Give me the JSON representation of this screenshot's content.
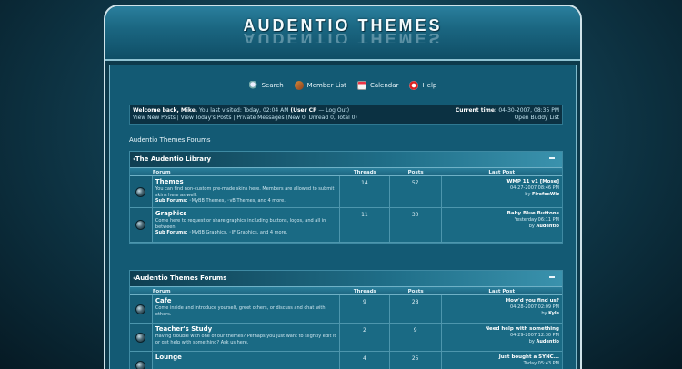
{
  "header": {
    "logo_text": "AUDENTIO THEMES"
  },
  "nav": [
    {
      "label": "Search",
      "icon": "search-icon"
    },
    {
      "label": "Member List",
      "icon": "members-icon"
    },
    {
      "label": "Calendar",
      "icon": "calendar-icon"
    },
    {
      "label": "Help",
      "icon": "help-icon"
    }
  ],
  "welcome": {
    "greeting": "Welcome back, Mike.",
    "last_visited": " You last visited: Today, 02:04 AM ",
    "user_cp": "(User CP",
    "logout": " — Log Out)",
    "links": "View New Posts | View Today's Posts | Private Messages",
    "pm_counts": " (New 0, Unread 0, Total 0)",
    "current_time_label": "Current time:",
    "current_time": " 04-30-2007, 08:35 PM",
    "buddy_list": "Open Buddy List"
  },
  "board_title": "Audentio Themes Forums",
  "columns": {
    "forum": "Forum",
    "threads": "Threads",
    "posts": "Posts",
    "last_post": "Last Post"
  },
  "categories": [
    {
      "title": "The Audentio Library",
      "forums": [
        {
          "name": "Themes",
          "desc": "You can find non-custom pre-made skins here. Members are allowed to submit skins here as well.",
          "subforums_label": "Sub Forums:",
          "subforums": " ◦MyBB Themes, ◦vB Themes, and 4 more.",
          "threads": "14",
          "posts": "57",
          "last_title": "WMP 11 v1 [Mose]",
          "last_date": "04-27-2007 08:46 PM",
          "last_by_label": "by ",
          "last_by": "FirefoxWiz"
        },
        {
          "name": "Graphics",
          "desc": "Come here to request or share graphics including buttons, logos, and all in between.",
          "subforums_label": "Sub Forums:",
          "subforums": " ◦MyBB Graphics, ◦IF Graphics, and 4 more.",
          "threads": "11",
          "posts": "30",
          "last_title": "Baby Blue Buttons",
          "last_date": "Yesterday 06:11 PM",
          "last_by_label": "by ",
          "last_by": "Audentio"
        }
      ]
    },
    {
      "title": "Audentio Themes Forums",
      "forums": [
        {
          "name": "Cafe",
          "desc": "Come inside and introduce yourself, greet others, or discuss and chat with others.",
          "subforums_label": "",
          "subforums": "",
          "threads": "9",
          "posts": "28",
          "last_title": "How'd you find us?",
          "last_date": "04-28-2007 02:09 PM",
          "last_by_label": "by ",
          "last_by": "Kyle"
        },
        {
          "name": "Teacher's Study",
          "desc": "Having trouble with one of our themes? Perhaps you just want to slightly edit it or get help with something? Ask us here.",
          "subforums_label": "",
          "subforums": "",
          "threads": "2",
          "posts": "9",
          "last_title": "Need help with something",
          "last_date": "04-29-2007 12:30 PM",
          "last_by_label": "by ",
          "last_by": "Audentio"
        },
        {
          "name": "Lounge",
          "desc": "",
          "subforums_label": "",
          "subforums": "",
          "threads": "4",
          "posts": "25",
          "last_title": "Just bought a SYNC...",
          "last_date": "Today 05:43 PM",
          "last_by_label": "",
          "last_by": ""
        }
      ]
    }
  ]
}
